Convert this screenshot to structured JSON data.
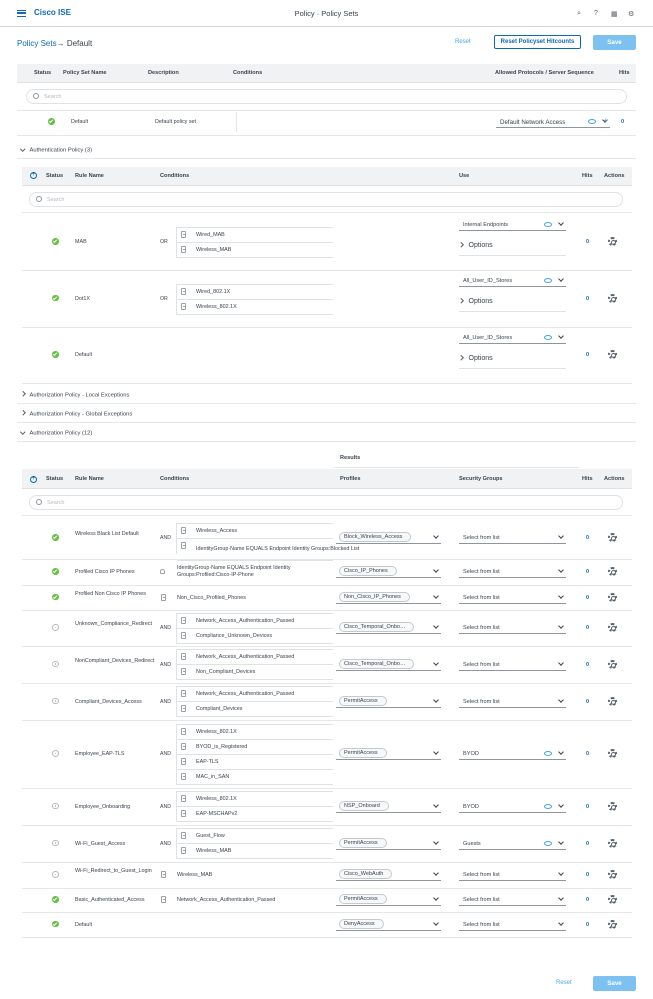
{
  "header": {
    "app": "Cisco ISE",
    "title": "Policy · Policy Sets"
  },
  "breadcrumb": {
    "root": "Policy Sets",
    "sep": "→",
    "current": "Default"
  },
  "buttons": {
    "reset": "Reset",
    "reset_hit": "Reset Policyset Hitcounts",
    "save": "Save"
  },
  "policy_set": {
    "cols": [
      "Status",
      "Policy Set Name",
      "Description",
      "Conditions",
      "Allowed Protocols / Server Sequence",
      "Hits"
    ],
    "search": "Search",
    "row": {
      "name": "Default",
      "desc": "Default policy set",
      "protocol": "Default Network Access",
      "hits": "0"
    }
  },
  "authn": {
    "title": "Authentication Policy (3)",
    "cols": [
      "Status",
      "Rule Name",
      "Conditions",
      "Use",
      "Hits",
      "Actions"
    ],
    "search": "Search",
    "rows": [
      {
        "name": "MAB",
        "op": "OR",
        "conds": [
          "Wired_MAB",
          "Wireless_MAB"
        ],
        "use": "Internal Endpoints",
        "options": "Options",
        "hits": "0"
      },
      {
        "name": "Dot1X",
        "op": "OR",
        "conds": [
          "Wired_802.1X",
          "Wireless_802.1X"
        ],
        "use": "All_User_ID_Stores",
        "options": "Options",
        "hits": "0"
      },
      {
        "name": "Default",
        "op": "",
        "conds": [],
        "use": "All_User_ID_Stores",
        "options": "Options",
        "hits": "0"
      }
    ]
  },
  "sections": {
    "local": "Authorization Policy - Local Exceptions",
    "global": "Authorization Policy - Global Exceptions",
    "authz": "Authorization Policy (12)"
  },
  "authz": {
    "results": "Results",
    "cols": [
      "Status",
      "Rule Name",
      "Conditions",
      "Profiles",
      "Security Groups",
      "Hits",
      "Actions"
    ],
    "search": "Search",
    "rows": [
      {
        "status": "ok",
        "name": "Wireless Black List Default",
        "op": "AND",
        "conds": [
          "Wireless_Access",
          "IdentityGroup·Name EQUALS Endpoint Identity Groups:Blocked List"
        ],
        "profile": "Block_Wireless_Access",
        "sg": "Select from list",
        "hits": "0"
      },
      {
        "status": "ok",
        "name": "Profiled Cisco IP Phones",
        "op": "",
        "conds": [
          "IdentityGroup·Name EQUALS Endpoint Identity Groups:Profiled:Cisco-IP-Phone"
        ],
        "profile": "Cisco_IP_Phones",
        "sg": "Select from list",
        "hits": "0"
      },
      {
        "status": "ok",
        "name": "Profiled Non Cisco IP Phones",
        "op": "",
        "conds": [
          "Non_Cisco_Profiled_Phones"
        ],
        "profile": "Non_Cisco_IP_Phones",
        "sg": "Select from list",
        "hits": "0"
      },
      {
        "status": "off",
        "name": "Unknown_Compliance_Redirect",
        "op": "AND",
        "conds": [
          "Network_Access_Authentication_Passed",
          "Compliance_Unknown_Devices"
        ],
        "profile": "Cisco_Temporal_Onbo…",
        "sg": "Select from list",
        "hits": "0"
      },
      {
        "status": "off",
        "name": "NonCompliant_Devices_Redirect",
        "op": "AND",
        "conds": [
          "Network_Access_Authentication_Passed",
          "Non_Compliant_Devices"
        ],
        "profile": "Cisco_Temporal_Onbo…",
        "sg": "Select from list",
        "hits": "0"
      },
      {
        "status": "off",
        "name": "Compliant_Devices_Access",
        "op": "AND",
        "conds": [
          "Network_Access_Authentication_Passed",
          "Compliant_Devices"
        ],
        "profile": "PermitAccess",
        "sg": "Select from list",
        "hits": "0"
      },
      {
        "status": "off",
        "name": "Employee_EAP-TLS",
        "op": "AND",
        "conds": [
          "Wireless_802.1X",
          "BYOD_is_Registered",
          "EAP-TLS",
          "MAC_in_SAN"
        ],
        "profile": "PermitAccess",
        "sg": "BYOD",
        "hits": "0"
      },
      {
        "status": "off",
        "name": "Employee_Onboarding",
        "op": "AND",
        "conds": [
          "Wireless_802.1X",
          "EAP-MSCHAPv2"
        ],
        "profile": "NSP_Onboard",
        "sg": "BYOD",
        "hits": "0"
      },
      {
        "status": "off",
        "name": "Wi-Fi_Guest_Access",
        "op": "AND",
        "conds": [
          "Guest_Flow",
          "Wireless_MAB"
        ],
        "profile": "PermitAccess",
        "sg": "Guests",
        "hits": "0"
      },
      {
        "status": "off",
        "name": "Wi-Fi_Redirect_to_Guest_Login",
        "op": "",
        "conds": [
          "Wireless_MAB"
        ],
        "profile": "Cisco_WebAuth",
        "sg": "Select from list",
        "hits": "0"
      },
      {
        "status": "ok",
        "name": "Basic_Authenticated_Access",
        "op": "",
        "conds": [
          "Network_Access_Authentication_Passed"
        ],
        "profile": "PermitAccess",
        "sg": "Select from list",
        "hits": "0"
      },
      {
        "status": "ok",
        "name": "Default",
        "op": "",
        "conds": [],
        "profile": "DenyAccess",
        "sg": "Select from list",
        "hits": "0"
      }
    ]
  },
  "colors": {
    "brand": "#0d6bb3",
    "ok": "#6abf4b",
    "save": "#7cc1f0"
  }
}
